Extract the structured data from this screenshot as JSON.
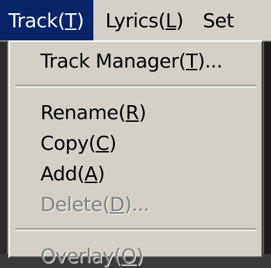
{
  "menubar": {
    "items": [
      {
        "label": "Track",
        "mnemonic": "T"
      },
      {
        "label": "Lyrics",
        "mnemonic": "L"
      },
      {
        "label": "Set",
        "mnemonic": ""
      }
    ]
  },
  "track_menu": {
    "items": [
      {
        "label": "Track Manager",
        "mnemonic": "T",
        "suffix": "...",
        "enabled": true
      },
      {
        "label": "Rename",
        "mnemonic": "R",
        "suffix": "",
        "enabled": true
      },
      {
        "label": "Copy",
        "mnemonic": "C",
        "suffix": "",
        "enabled": true
      },
      {
        "label": "Add",
        "mnemonic": "A",
        "suffix": "",
        "enabled": true
      },
      {
        "label": "Delete",
        "mnemonic": "D",
        "suffix": "...",
        "enabled": false
      },
      {
        "label": "Overlay",
        "mnemonic": "O",
        "suffix": "",
        "enabled": false
      }
    ]
  },
  "colors": {
    "menu_face": "#d4d0c8",
    "highlight": "#0a246a",
    "disabled_text": "#808080"
  }
}
